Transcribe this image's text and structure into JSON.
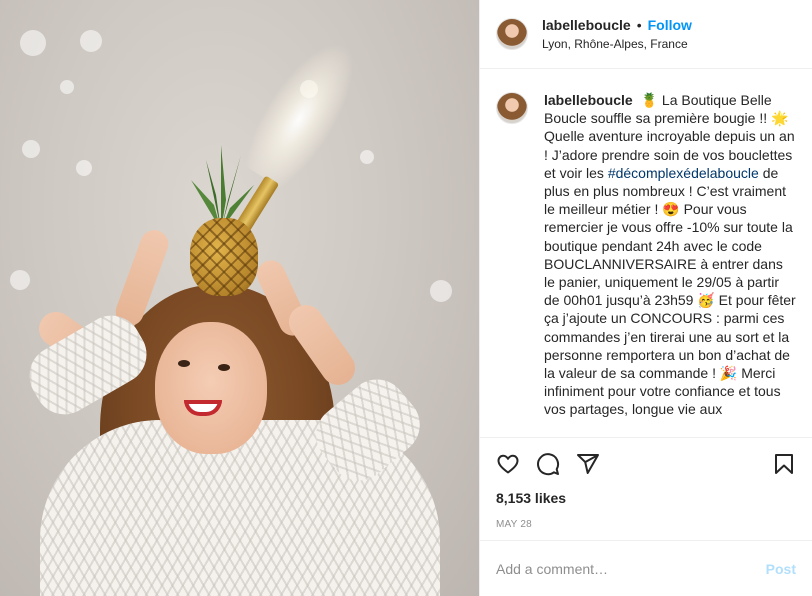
{
  "post": {
    "username": "labelleboucle",
    "location": "Lyon, Rhône-Alpes, France",
    "follow_label": "Follow",
    "dot": "•",
    "caption": {
      "part1": "La Boutique Belle Boucle souffle sa première bougie !! 🌟 Quelle aventure incroyable depuis un an ! J’adore prendre soin de vos bouclettes et voir les ",
      "hashtag": "#décomplexédelaboucle",
      "part2": " de plus en plus nombreux ! C’est vraiment le meilleur métier ! 😍 Pour vous remercier je vous offre -10% sur toute la boutique pendant 24h avec le code BOUCLANNIVERSAIRE à entrer dans le panier, uniquement le 29/05 à partir de 00h01 jusqu’à 23h59 🥳 Et pour fêter ça j’ajoute un CONCOURS : parmi ces commandes j’en tirerai une au sort et la personne remportera un bon d’achat de la valeur de sa commande ! 🎉 Merci infiniment pour votre confiance et tous vos partages, longue vie aux"
    },
    "likes": "8,153 likes",
    "date": "MAY 28",
    "comment_placeholder": "Add a comment…",
    "post_label": "Post",
    "icons": [
      "heart-icon",
      "comment-icon",
      "share-icon",
      "bookmark-icon"
    ]
  },
  "colors": {
    "link_blue": "#0095f6",
    "hashtag": "#00376b",
    "muted": "#8e8e8e",
    "post_disabled": "#b2dffc",
    "text": "#262626"
  }
}
